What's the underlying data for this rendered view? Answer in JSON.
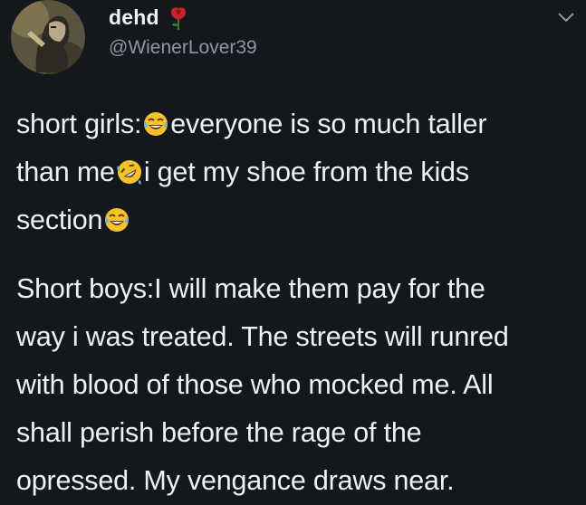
{
  "user": {
    "display_name": "dehd",
    "handle": "@WienerLover39",
    "name_icon": "rose-icon"
  },
  "menu_icon": "chevron-down-icon",
  "tweet": {
    "paragraph1": {
      "line1_a": "short girls:",
      "line1_b": "everyone is so much taller",
      "line2_a": "than me",
      "line2_b": "i get my shoe from the kids",
      "line3_a": "section"
    },
    "paragraph2": {
      "line1": "Short boys:I will make them pay for the",
      "line2": "way i was treated. The streets will runred",
      "line3": "with blood of those who mocked me. All",
      "line4": "shall perish before the rage of the",
      "line5": "opressed. My vengance draws near."
    },
    "emojis": [
      "tears-of-joy-icon",
      "rolling-on-floor-laughing-icon",
      "tears-of-joy-icon"
    ]
  },
  "colors": {
    "background": "#14171c",
    "text": "#eef1f4",
    "handle": "#8b98a5",
    "emoji": "#f5c22b"
  }
}
